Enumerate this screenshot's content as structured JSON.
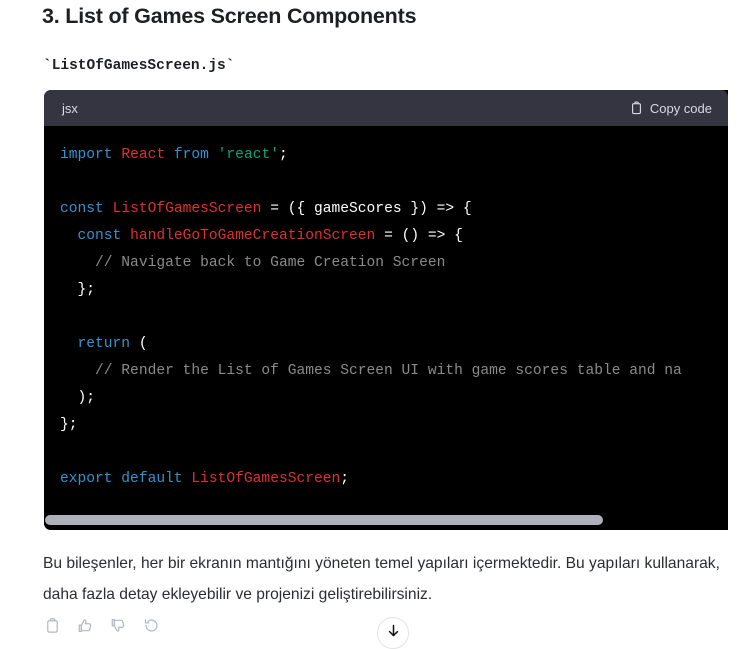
{
  "heading": "3. List of Games Screen Components",
  "filename_inline": "`ListOfGamesScreen.js`",
  "code_block": {
    "language_label": "jsx",
    "copy_label": "Copy code",
    "copy_icon": "clipboard-icon",
    "lines": [
      "import React from 'react';",
      "",
      "const ListOfGamesScreen = ({ gameScores }) => {",
      "  const handleGoToGameCreationScreen = () => {",
      "    // Navigate back to Game Creation Screen",
      "  };",
      "",
      "  return (",
      "    // Render the List of Games Screen UI with game scores table and na",
      "  );",
      "};",
      "",
      "export default ListOfGamesScreen;"
    ],
    "colors": {
      "header_bg": "#343541",
      "body_bg": "#000000",
      "keyword": "#2e95d3",
      "identifier": "#e02f2f",
      "string": "#00a67d",
      "comment": "#8b8b8b",
      "plain": "#ffffff",
      "scrollbar_thumb": "#b0b0ba"
    },
    "scroll_position_percent": 0
  },
  "paragraph": "Bu bileşenler, her bir ekranın mantığını yöneten temel yapıları içermektedir. Bu yapıları kullanarak, daha fazla detay ekleyebilir ve projenizi geliştirebilirsiniz.",
  "actions": [
    {
      "name": "copy-icon",
      "label": "Copy"
    },
    {
      "name": "thumbs-up-icon",
      "label": "Good response"
    },
    {
      "name": "thumbs-down-icon",
      "label": "Bad response"
    },
    {
      "name": "regenerate-icon",
      "label": "Regenerate"
    }
  ],
  "scroll_down_button": {
    "name": "arrow-down-icon",
    "label": "Scroll to bottom"
  }
}
